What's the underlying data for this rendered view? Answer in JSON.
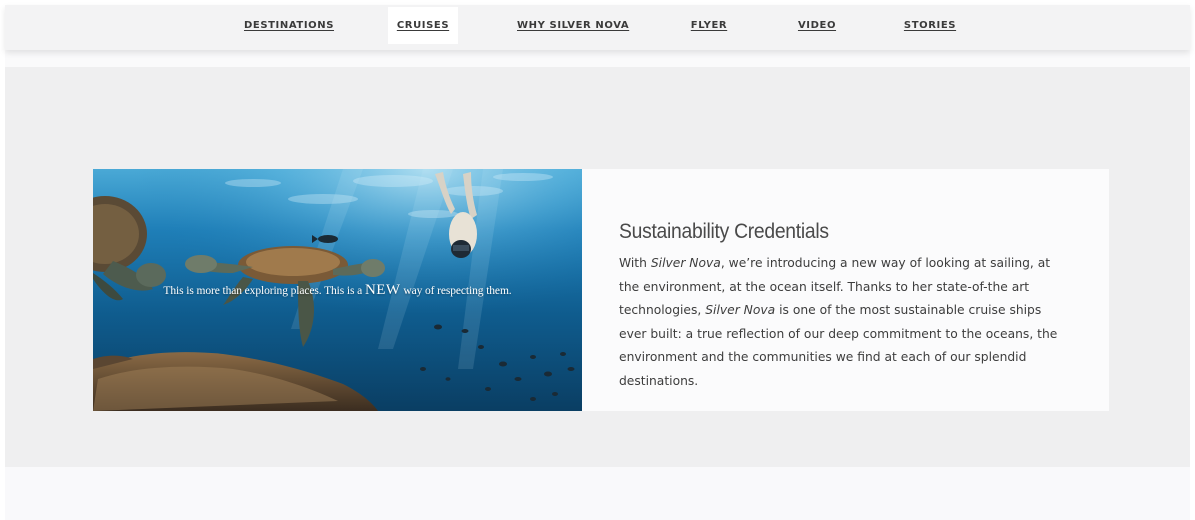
{
  "nav": {
    "items": [
      {
        "label": "DESTINATIONS",
        "active": false
      },
      {
        "label": "CRUISES",
        "active": true
      },
      {
        "label": "WHY SILVER NOVA",
        "active": false
      },
      {
        "label": "FLYER",
        "active": false
      },
      {
        "label": "VIDEO",
        "active": false
      },
      {
        "label": "STORIES",
        "active": false
      }
    ]
  },
  "hero": {
    "overlay_before": "This is more than exploring places. This is a ",
    "overlay_emphasis": "NEW",
    "overlay_after": " way of respecting them."
  },
  "card": {
    "title": "Sustainability Credentials",
    "lines": [
      {
        "pre": "With ",
        "em": "Silver Nova",
        "post": ", we’re introducing a new way of looking at sailing, at"
      },
      {
        "pre": "the environment, at the ocean itself. Thanks to her state-of-the art",
        "em": "",
        "post": ""
      },
      {
        "pre": "technologies, ",
        "em": "Silver Nova",
        "post": " is one of the most sustainable cruise ships"
      },
      {
        "pre": "ever built: a true reflection of our deep commitment to the oceans, the",
        "em": "",
        "post": ""
      },
      {
        "pre": "environment and the communities we find at each of our splendid",
        "em": "",
        "post": ""
      },
      {
        "pre": "destinations.",
        "em": "",
        "post": ""
      }
    ]
  },
  "colors": {
    "nav_bg": "#f3f3f4",
    "section_bg": "#efeff0",
    "card_bg": "#fbfbfc",
    "ocean_deep": "#0b3f63",
    "ocean_light": "#3f9fd0"
  },
  "icons": {
    "hero_scene": "ocean-turtles-image"
  }
}
